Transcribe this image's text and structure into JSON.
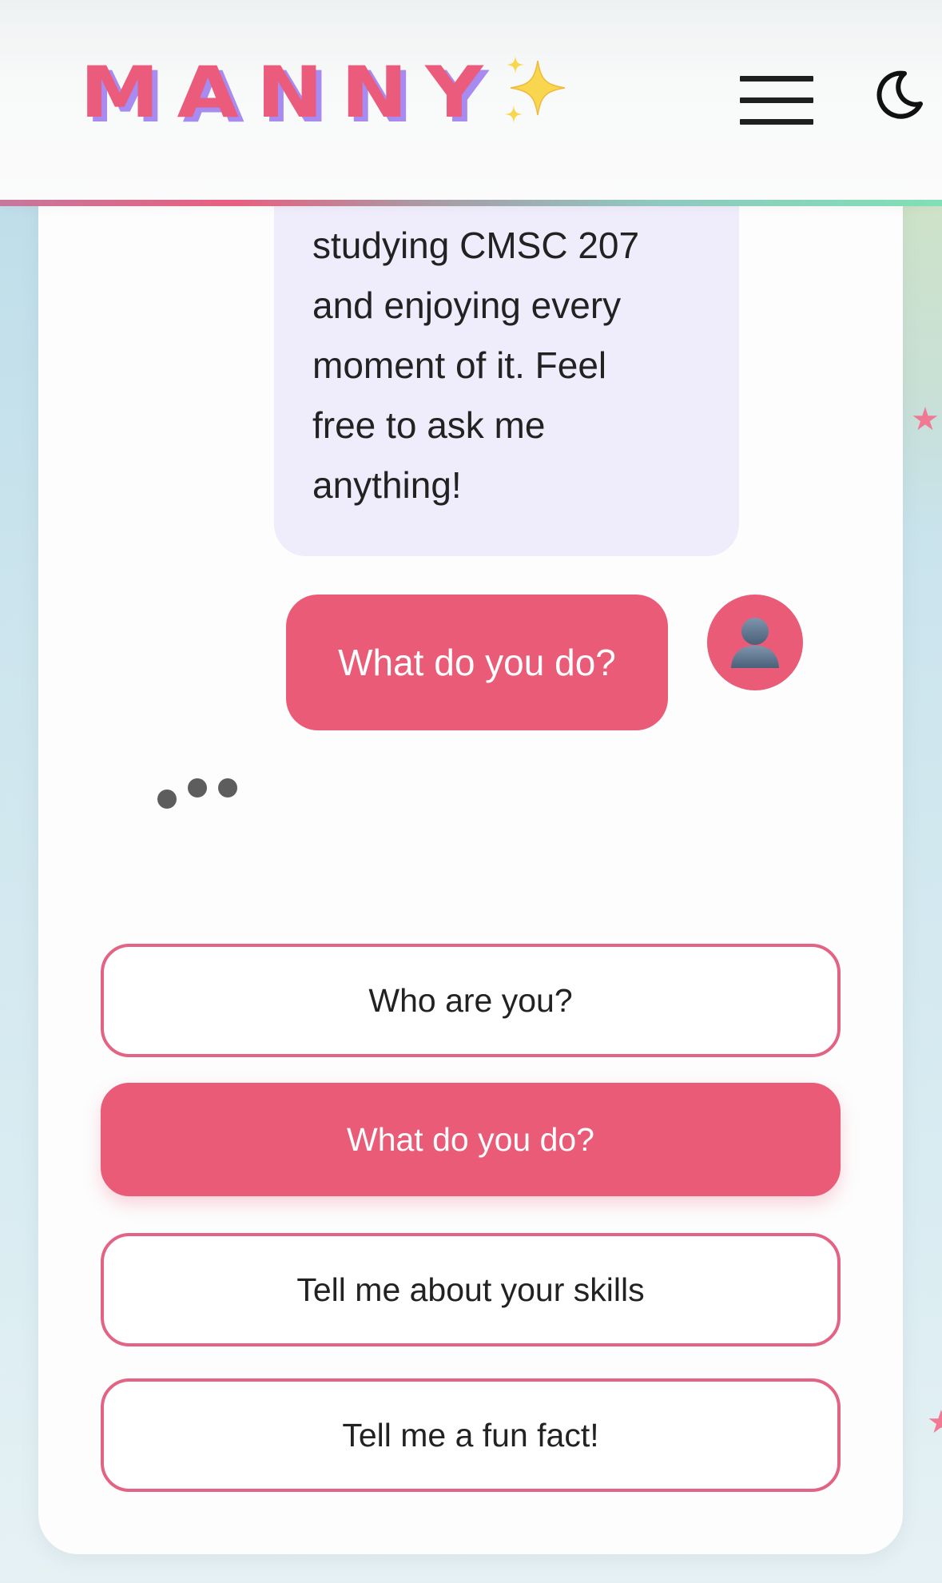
{
  "header": {
    "logo_text": "MANNY",
    "logo_icon": "sparkles-icon",
    "menu_icon": "hamburger-menu-icon",
    "theme_icon": "moon-icon"
  },
  "chat": {
    "bot_message_lines": [
      "studying CMSC 207",
      "and enjoying every",
      "moment of it. Feel",
      "free to ask me",
      "anything!"
    ],
    "user_message": "What do you do?",
    "user_avatar_icon": "user-silhouette-icon",
    "typing_indicator": "typing-dots"
  },
  "quick_replies": [
    {
      "label": "Who are you?",
      "selected": false
    },
    {
      "label": "What do you do?",
      "selected": true
    },
    {
      "label": "Tell me about your skills",
      "selected": false
    },
    {
      "label": "Tell me a fun fact!",
      "selected": false
    }
  ],
  "colors": {
    "brand_pink": "#ea5b77",
    "logo_shadow_purple": "#a78bf0",
    "bot_bubble": "#efecfb",
    "page_background": "#cfe6ee"
  }
}
